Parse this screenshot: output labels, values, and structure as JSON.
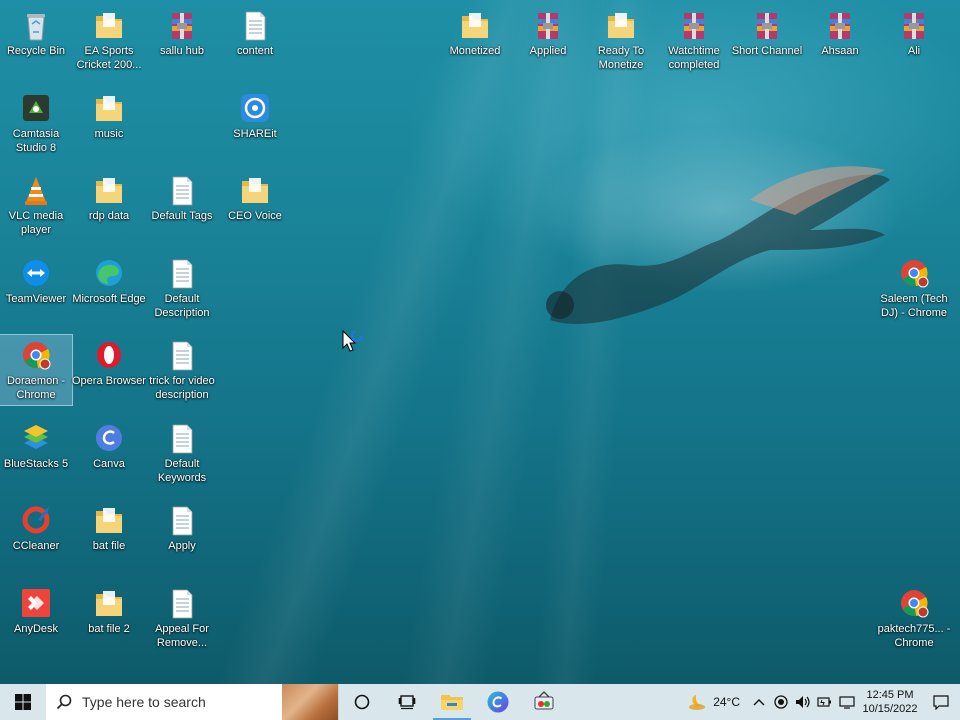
{
  "desktop_icons": [
    {
      "label": "Recycle Bin",
      "icon": "recycle-bin-icon"
    },
    {
      "label": "EA Sports Cricket 200...",
      "icon": "folder-icon"
    },
    {
      "label": "sallu hub",
      "icon": "winrar-archive-icon"
    },
    {
      "label": "content",
      "icon": "text-document-icon"
    },
    {
      "label": "Camtasia Studio 8",
      "icon": "camtasia-icon"
    },
    {
      "label": "music",
      "icon": "folder-icon"
    },
    {
      "label": "SHAREit",
      "icon": "shareit-icon"
    },
    {
      "label": "VLC media player",
      "icon": "vlc-icon"
    },
    {
      "label": "rdp data",
      "icon": "folder-icon"
    },
    {
      "label": "Default Tags",
      "icon": "text-document-icon"
    },
    {
      "label": "CEO Voice",
      "icon": "folder-icon"
    },
    {
      "label": "TeamViewer",
      "icon": "teamviewer-icon"
    },
    {
      "label": "Microsoft Edge",
      "icon": "edge-icon"
    },
    {
      "label": "Default Description",
      "icon": "text-document-icon"
    },
    {
      "label": "Doraemon - Chrome",
      "icon": "chrome-profile-icon"
    },
    {
      "label": "Opera Browser",
      "icon": "opera-icon"
    },
    {
      "label": "trick for video description",
      "icon": "text-document-icon"
    },
    {
      "label": "BlueStacks 5",
      "icon": "bluestacks-icon"
    },
    {
      "label": "Canva",
      "icon": "canva-icon"
    },
    {
      "label": "Default Keywords",
      "icon": "text-document-icon"
    },
    {
      "label": "CCleaner",
      "icon": "ccleaner-icon"
    },
    {
      "label": "bat file",
      "icon": "folder-icon"
    },
    {
      "label": "Apply",
      "icon": "text-document-icon"
    },
    {
      "label": "AnyDesk",
      "icon": "anydesk-icon"
    },
    {
      "label": "bat file 2",
      "icon": "folder-icon"
    },
    {
      "label": "Appeal For Remove...",
      "icon": "text-document-icon"
    },
    {
      "label": "Monetized",
      "icon": "folder-icon"
    },
    {
      "label": "Applied",
      "icon": "winrar-archive-icon"
    },
    {
      "label": "Ready To Monetize",
      "icon": "folder-icon"
    },
    {
      "label": "Watchtime completed",
      "icon": "winrar-archive-icon"
    },
    {
      "label": "Short Channel",
      "icon": "winrar-archive-icon"
    },
    {
      "label": "Ahsaan",
      "icon": "winrar-archive-icon"
    },
    {
      "label": "Ali",
      "icon": "winrar-archive-icon"
    },
    {
      "label": "Saleem (Tech DJ) - Chrome",
      "icon": "chrome-profile-icon"
    },
    {
      "label": "paktech775... - Chrome",
      "icon": "chrome-profile-icon"
    }
  ],
  "taskbar": {
    "search_placeholder": "Type here to search",
    "weather": "24°C",
    "time": "12:45 PM",
    "date": "10/15/2022"
  },
  "colors": {
    "taskbar": "#d9e6ec",
    "selection": "#a0c8e6",
    "water": "#1a8499"
  }
}
